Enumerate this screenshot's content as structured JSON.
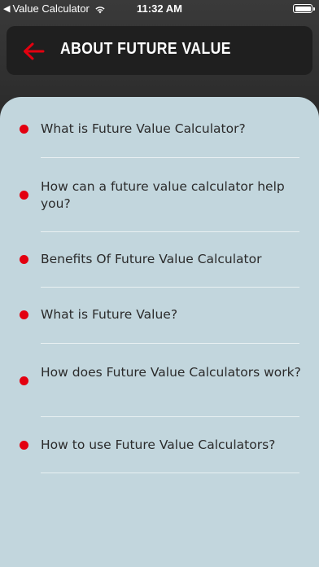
{
  "status_bar": {
    "back_app": "Value Calculator",
    "time": "11:32 AM"
  },
  "header": {
    "title": "ABOUT FUTURE VALUE",
    "back_icon": "arrow-left-icon",
    "accent_color": "#e3000f"
  },
  "faq": {
    "items": [
      {
        "label": "What is Future Value Calculator?"
      },
      {
        "label": "How can a future value calculator help you?"
      },
      {
        "label": "Benefits Of Future Value Calculator"
      },
      {
        "label": "What is Future Value?"
      },
      {
        "label": "How does Future Value Calculators work?"
      },
      {
        "label": "How to use Future Value Calculators?"
      }
    ]
  }
}
